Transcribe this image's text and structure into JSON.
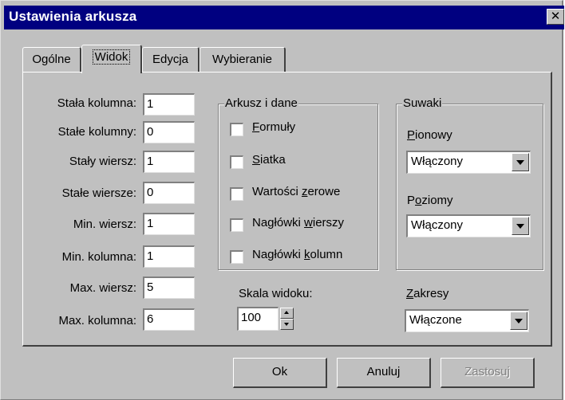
{
  "window": {
    "title": "Ustawienia arkusza",
    "close_glyph": "✕"
  },
  "tabs": [
    {
      "label": "Ogólne"
    },
    {
      "label": "Widok",
      "active": true
    },
    {
      "label": "Edycja"
    },
    {
      "label": "Wybieranie"
    }
  ],
  "fields": [
    {
      "label": "Stała kolumna:",
      "value": "1"
    },
    {
      "label": "Stałe kolumny:",
      "value": "0"
    },
    {
      "label": "Stały wiersz:",
      "value": "1"
    },
    {
      "label": "Stałe wiersze:",
      "value": "0"
    },
    {
      "label": "Min. wiersz:",
      "value": "1"
    },
    {
      "label": "Min. kolumna:",
      "value": "1"
    },
    {
      "label": "Max. wiersz:",
      "value": "5"
    },
    {
      "label": "Max. kolumna:",
      "value": "6"
    }
  ],
  "data_group": {
    "title": "Arkusz i dane",
    "checkboxes": [
      {
        "pre": "",
        "u": "F",
        "post": "ormuły",
        "checked": false
      },
      {
        "pre": "",
        "u": "S",
        "post": "iatka",
        "checked": false
      },
      {
        "pre": "Wartości ",
        "u": "z",
        "post": "erowe",
        "checked": false
      },
      {
        "pre": "Nagłówki ",
        "u": "w",
        "post": "ierszy",
        "checked": false
      },
      {
        "pre": "Nagłówki ",
        "u": "k",
        "post": "olumn",
        "checked": false
      }
    ]
  },
  "sliders_group": {
    "title": "Suwaki",
    "vertical": {
      "pre": "",
      "u": "P",
      "post": "ionowy",
      "value": "Włączony"
    },
    "horizontal": {
      "pre": "P",
      "u": "o",
      "post": "ziomy",
      "value": "Włączony"
    }
  },
  "scale": {
    "label": "Skala widoku:",
    "value": "100"
  },
  "ranges": {
    "pre": "",
    "u": "Z",
    "post": "akresy",
    "value": "Włączone"
  },
  "buttons": {
    "ok": "Ok",
    "cancel": "Anuluj",
    "apply": "Zastosuj"
  }
}
